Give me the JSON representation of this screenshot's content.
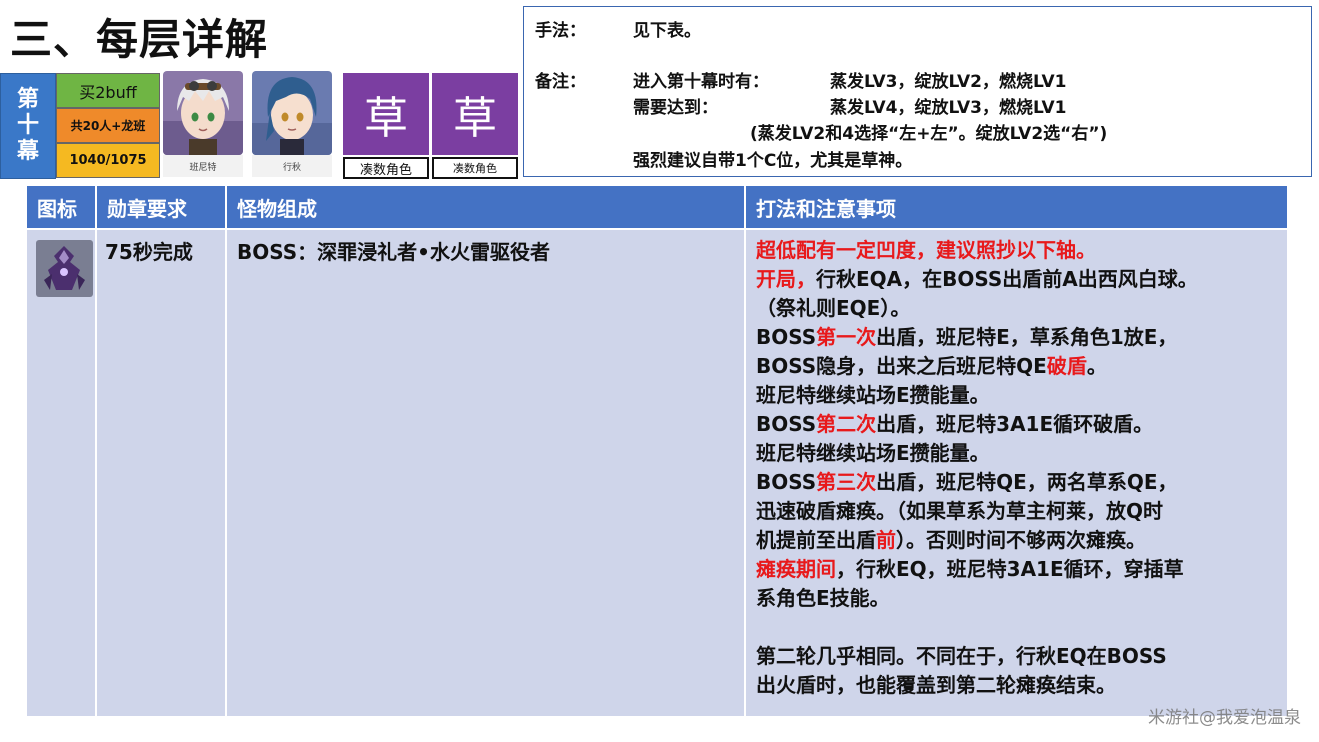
{
  "section_title": "三、每层详解",
  "floor": {
    "chars": [
      "第",
      "十",
      "幕"
    ]
  },
  "info": {
    "buff": "买2buff",
    "people": "共20人+龙班",
    "score": "1040/1075"
  },
  "characters": [
    {
      "name": "班尼特"
    },
    {
      "name": "行秋"
    }
  ],
  "element_slots": [
    {
      "element": "草",
      "role": "凑数角色"
    },
    {
      "element": "草",
      "role": "凑数角色"
    }
  ],
  "notes": {
    "method_label": "手法：",
    "method_value": "见下表。",
    "remark_label": "备注：",
    "enter_label": "进入第十幕时有：",
    "enter_value": "蒸发LV3，绽放LV2，燃烧LV1",
    "need_label": "需要达到：",
    "need_value": "蒸发LV4，绽放LV3，燃烧LV1",
    "choice": "(蒸发LV2和4选择“左+左”。绽放LV2选“右”)",
    "suggest": "强烈建议自带1个C位，尤其是草神。"
  },
  "table": {
    "headers": [
      "图标",
      "勋章要求",
      "怪物组成",
      "打法和注意事项"
    ],
    "row": {
      "medal": "75秒完成",
      "monsters": "BOSS：深罪浸礼者•水火雷驱役者"
    }
  },
  "tactics": [
    [
      {
        "t": "超低配有一定凹度，建议照抄以下轴。",
        "red": true
      }
    ],
    [
      {
        "t": "开局，",
        "red": true
      },
      {
        "t": "行秋EQA，在BOSS出盾前A出西风白球。"
      }
    ],
    [
      {
        "t": "（祭礼则EQE）。"
      }
    ],
    [
      {
        "t": "BOSS"
      },
      {
        "t": "第一次",
        "red": true
      },
      {
        "t": "出盾，班尼特E，草系角色1放E，"
      }
    ],
    [
      {
        "t": "BOSS隐身，出来之后班尼特QE"
      },
      {
        "t": "破盾",
        "red": true
      },
      {
        "t": "。"
      }
    ],
    [
      {
        "t": "班尼特继续站场E攒能量。"
      }
    ],
    [
      {
        "t": "BOSS"
      },
      {
        "t": "第二次",
        "red": true
      },
      {
        "t": "出盾，班尼特3A1E循环破盾。"
      }
    ],
    [
      {
        "t": "班尼特继续站场E攒能量。"
      }
    ],
    [
      {
        "t": "BOSS"
      },
      {
        "t": "第三次",
        "red": true
      },
      {
        "t": "出盾，班尼特QE，两名草系QE，"
      }
    ],
    [
      {
        "t": "迅速破盾瘫痪。（如果草系为草主柯莱，放Q时"
      }
    ],
    [
      {
        "t": "机提前至出盾"
      },
      {
        "t": "前",
        "red": true
      },
      {
        "t": "）。否则时间不够两次瘫痪。"
      }
    ],
    [
      {
        "t": "瘫痪期间",
        "red": true
      },
      {
        "t": "，行秋EQ，班尼特3A1E循环，穿插草"
      }
    ],
    [
      {
        "t": "系角色E技能。"
      }
    ],
    [],
    [
      {
        "t": "第二轮几乎相同。不同在于，行秋EQ在BOSS"
      }
    ],
    [
      {
        "t": "出火盾时，也能覆盖到第二轮瘫痪结束。"
      }
    ]
  ],
  "watermark": "米游社@我爱泡温泉"
}
